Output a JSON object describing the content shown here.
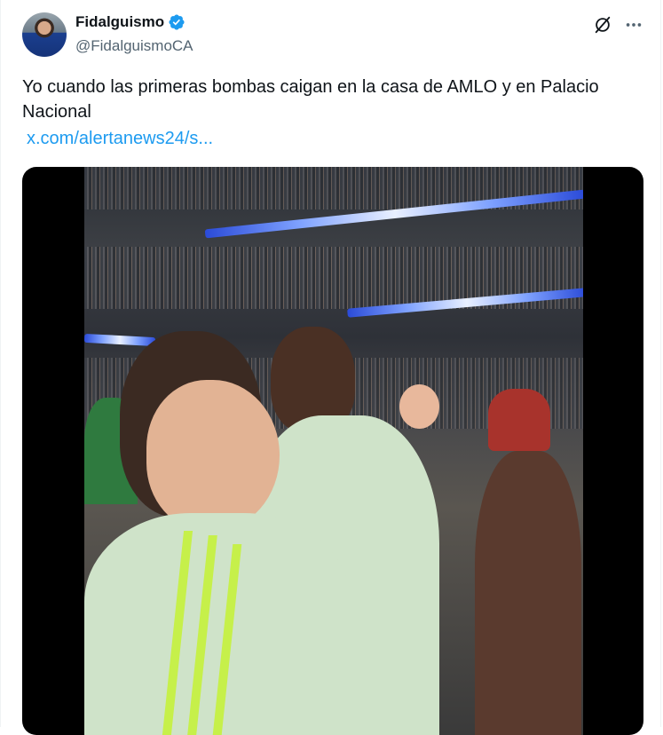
{
  "author": {
    "display_name": "Fidalguismo",
    "handle": "@FidalguismoCA",
    "verified": true
  },
  "tweet": {
    "text": "Yo cuando las primeras bombas caigan en la casa de AMLO y en Palacio Nacional",
    "link_text": "x.com/alertanews24/s..."
  },
  "icons": {
    "verified": "verified-badge-icon",
    "grok": "grok-icon",
    "more": "more-icon"
  },
  "colors": {
    "accent": "#1d9bf0",
    "text": "#0f1419",
    "secondary": "#536471"
  }
}
